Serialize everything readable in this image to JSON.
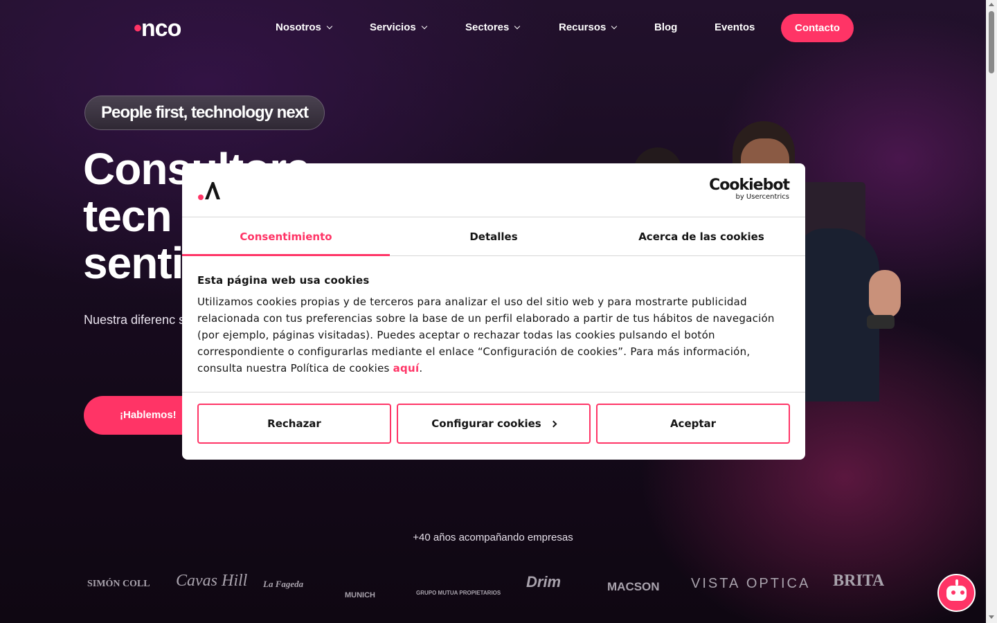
{
  "header": {
    "logo": "·nco",
    "logo_dot": "•",
    "logo_text": "nco",
    "nav": [
      {
        "label": "Nosotros",
        "has_dropdown": true
      },
      {
        "label": "Servicios",
        "has_dropdown": true
      },
      {
        "label": "Sectores",
        "has_dropdown": true
      },
      {
        "label": "Recursos",
        "has_dropdown": true
      },
      {
        "label": "Blog",
        "has_dropdown": false
      },
      {
        "label": "Eventos",
        "has_dropdown": false
      }
    ],
    "contact_label": "Contacto"
  },
  "hero": {
    "tagline": "People first, technology next",
    "title_lines": [
      "Consultora",
      "tecn",
      "senti"
    ],
    "subtitle": "Nuestra diferenc soluciones IT ce manera cercanc",
    "cta_label": "¡Hablemos!"
  },
  "trust": {
    "label": "+40 años acompañando empresas",
    "brands": [
      "SIMÓN COLL",
      "Cavas Hill",
      "La Fageda",
      "MUNICH",
      "GRUPO MUTUA PROPIETARIOS",
      "Drim",
      "MACSON",
      "VISTA OPTICA",
      "BRITA"
    ]
  },
  "cookie_dialog": {
    "provider_main": "Cookiebot",
    "provider_sub": "by Usercentrics",
    "tabs": [
      {
        "label": "Consentimiento",
        "active": true
      },
      {
        "label": "Detalles",
        "active": false
      },
      {
        "label": "Acerca de las cookies",
        "active": false
      }
    ],
    "heading": "Esta página web usa cookies",
    "body": "Utilizamos cookies propias y de terceros para analizar el uso del sitio web y para mostrarte publicidad relacionada con tus preferencias sobre la base de un perfil elaborado a partir de tus hábitos de navegación (por ejemplo, páginas visitadas). Puedes aceptar o rechazar todas las cookies pulsando el botón correspondiente o configurarlas mediante el enlace “Configuración de cookies”. Para más información, consulta nuestra Política de cookies ",
    "link_label": "aquí",
    "body_end": ".",
    "buttons": {
      "reject": "Rechazar",
      "configure": "Configurar cookies",
      "accept": "Aceptar"
    }
  },
  "colors": {
    "accent": "#ff3466",
    "background": "#170b1e",
    "dialog_bg": "#ffffff"
  }
}
